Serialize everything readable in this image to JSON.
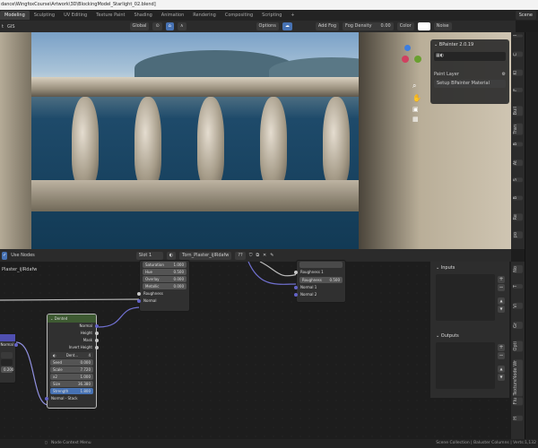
{
  "title": "dance\\WingfoxCourse\\Artwork\\3D\\BlockingModel_Starlight_02.blend]",
  "workspaces": [
    "Modeling",
    "Sculpting",
    "UV Editing",
    "Texture Paint",
    "Shading",
    "Animation",
    "Rendering",
    "Compositing",
    "Scripting",
    "+"
  ],
  "active_workspace": "Modeling",
  "scene": "Scene",
  "viewport_header": {
    "menu": "t",
    "gis": "GIS",
    "orientation": "Global",
    "options": "Options",
    "add_fog": "Add Fog",
    "fog_density_label": "Fog Density",
    "fog_density": "0.00",
    "color_label": "Color",
    "noise_label": "Noise"
  },
  "bpainter": {
    "title": "BPainter 2.0.19",
    "paint_layer": "Paint Layer",
    "setup": "Setup BPainter Material"
  },
  "viewport_tabs": [
    "I",
    "C",
    "Kl",
    "F",
    "Buil",
    "Tran",
    "B",
    "At",
    "S",
    "B",
    "Re",
    "po"
  ],
  "node_header": {
    "use_nodes": "Use Nodes",
    "slot": "Slot 1",
    "material": "Torn_Plaster_ijlRdafw",
    "users": "??"
  },
  "left_label": "Plaster_ijlRdafw",
  "node_top": {
    "rows": [
      {
        "label": "Saturation",
        "value": "1.000"
      },
      {
        "label": "Hue",
        "value": "0.500"
      },
      {
        "label": "Overlay",
        "value": "0.000"
      },
      {
        "label": "Metallic",
        "value": "0.000"
      }
    ],
    "sockets": [
      "Roughness",
      "Normal"
    ]
  },
  "node_right": {
    "roughness1": "Roughness 1",
    "roughness_field": "Roughness",
    "roughness_value": "0.500",
    "normal1": "Normal 1",
    "normal2": "Normal 2"
  },
  "node_dented": {
    "title": "Dented",
    "outputs": [
      "Normal",
      "Height",
      "Mask",
      "Invert Height"
    ],
    "dropdown": "Dent...",
    "count": "4",
    "fields": [
      {
        "label": "Seed",
        "value": "0.000"
      },
      {
        "label": "Scale",
        "value": "7.720"
      },
      {
        "label": "x2",
        "value": "1.000"
      },
      {
        "label": "Size",
        "value": "36.380"
      },
      {
        "label": "Strength",
        "value": "1.800"
      }
    ],
    "input": "Normal - Stack"
  },
  "node_left": {
    "socket": "Normal",
    "value": "0.200"
  },
  "node_sidebar": {
    "inputs": "Inputs",
    "outputs": "Outputs"
  },
  "node_tabs": [
    "No",
    "T",
    "Vi",
    "Gr",
    "Opti",
    "Node Wr",
    "Texture",
    "Flu",
    "H"
  ],
  "status": {
    "left": "Node Context Menu",
    "right": "Scene Collection | Baluster Columns | Verts:1,132"
  }
}
